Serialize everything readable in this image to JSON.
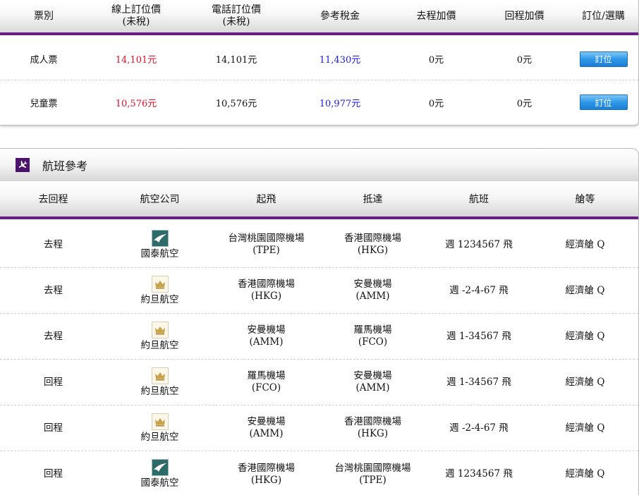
{
  "price_table": {
    "headers": [
      {
        "line1": "票別",
        "line2": ""
      },
      {
        "line1": "線上訂位價",
        "line2": "(未稅)"
      },
      {
        "line1": "電話訂位價",
        "line2": "(未稅)"
      },
      {
        "line1": "參考稅金",
        "line2": ""
      },
      {
        "line1": "去程加價",
        "line2": ""
      },
      {
        "line1": "回程加價",
        "line2": ""
      },
      {
        "line1": "訂位/選購",
        "line2": ""
      }
    ],
    "rows": [
      {
        "type": "成人票",
        "online": "14,101元",
        "phone": "14,101元",
        "tax": "11,430元",
        "out_extra": "0元",
        "ret_extra": "0元",
        "button": "訂位"
      },
      {
        "type": "兒童票",
        "online": "10,576元",
        "phone": "10,576元",
        "tax": "10,977元",
        "out_extra": "0元",
        "ret_extra": "0元",
        "button": "訂位"
      }
    ]
  },
  "flight_section": {
    "title": "航班參考",
    "icon": "airplane-icon",
    "headers": [
      "去回程",
      "航空公司",
      "起飛",
      "抵達",
      "航班",
      "艙等"
    ],
    "rows": [
      {
        "direction": "去程",
        "airline": "國泰航空",
        "logo": "cathay-logo-icon",
        "dep_name": "台灣桃園國際機場",
        "dep_code": "(TPE)",
        "arr_name": "香港國際機場",
        "arr_code": "(HKG)",
        "schedule": "週 1234567 飛",
        "cabin": "經濟艙 Q"
      },
      {
        "direction": "去程",
        "airline": "約旦航空",
        "logo": "royal-jordanian-logo-icon",
        "dep_name": "香港國際機場",
        "dep_code": "(HKG)",
        "arr_name": "安曼機場",
        "arr_code": "(AMM)",
        "schedule": "週 -2-4-67 飛",
        "cabin": "經濟艙 Q"
      },
      {
        "direction": "去程",
        "airline": "約旦航空",
        "logo": "royal-jordanian-logo-icon",
        "dep_name": "安曼機場",
        "dep_code": "(AMM)",
        "arr_name": "羅馬機場",
        "arr_code": "(FCO)",
        "schedule": "週 1-34567 飛",
        "cabin": "經濟艙 Q"
      },
      {
        "direction": "回程",
        "airline": "約旦航空",
        "logo": "royal-jordanian-logo-icon",
        "dep_name": "羅馬機場",
        "dep_code": "(FCO)",
        "arr_name": "安曼機場",
        "arr_code": "(AMM)",
        "schedule": "週 1-34567 飛",
        "cabin": "經濟艙 Q"
      },
      {
        "direction": "回程",
        "airline": "約旦航空",
        "logo": "royal-jordanian-logo-icon",
        "dep_name": "安曼機場",
        "dep_code": "(AMM)",
        "arr_name": "香港國際機場",
        "arr_code": "(HKG)",
        "schedule": "週 -2-4-67 飛",
        "cabin": "經濟艙 Q"
      },
      {
        "direction": "回程",
        "airline": "國泰航空",
        "logo": "cathay-logo-icon",
        "dep_name": "香港國際機場",
        "dep_code": "(HKG)",
        "arr_name": "台灣桃園國際機場",
        "arr_code": "(TPE)",
        "schedule": "週 1234567 飛",
        "cabin": "經濟艙 Q"
      }
    ]
  },
  "colors": {
    "accent_purple": "#6a1b8a",
    "online_price_red": "#e0102a",
    "tax_blue": "#1a1ae6",
    "button_blue": "#2e98e8"
  }
}
